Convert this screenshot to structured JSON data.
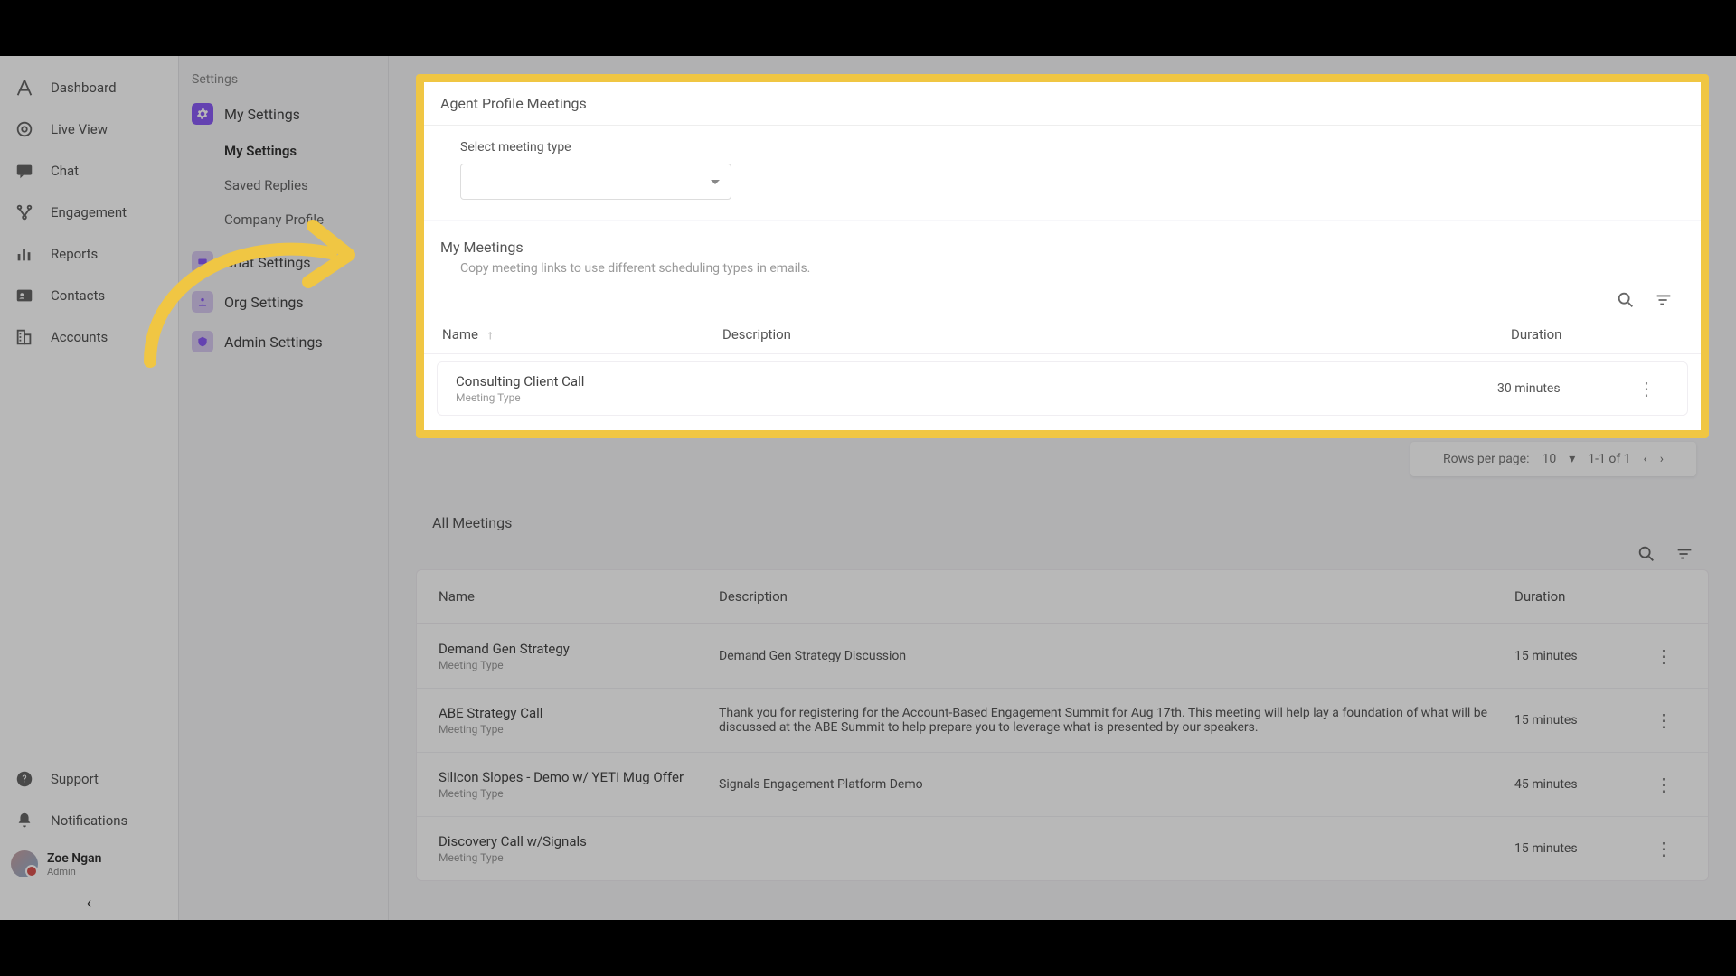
{
  "nav": {
    "items": [
      {
        "label": "Dashboard"
      },
      {
        "label": "Live View"
      },
      {
        "label": "Chat"
      },
      {
        "label": "Engagement"
      },
      {
        "label": "Reports"
      },
      {
        "label": "Contacts"
      },
      {
        "label": "Accounts"
      }
    ],
    "support": "Support",
    "notifications": "Notifications",
    "user": {
      "name": "Zoe Ngan",
      "role": "Admin"
    }
  },
  "settings": {
    "title": "Settings",
    "groups": {
      "my": {
        "label": "My Settings"
      },
      "chat": {
        "label": "Chat Settings"
      },
      "org": {
        "label": "Org Settings"
      },
      "admin": {
        "label": "Admin Settings"
      }
    },
    "my_items": [
      {
        "label": "My Settings",
        "active": true
      },
      {
        "label": "Saved Replies"
      },
      {
        "label": "Company Profile"
      }
    ]
  },
  "profile_card": {
    "title": "Agent Profile Meetings",
    "select_label": "Select meeting type"
  },
  "my_meetings": {
    "title": "My Meetings",
    "subtitle": "Copy meeting links to use different scheduling types in emails.",
    "cols": {
      "name": "Name",
      "desc": "Description",
      "dur": "Duration"
    },
    "rows": [
      {
        "name": "Consulting Client Call",
        "type": "Meeting Type",
        "desc": "",
        "dur": "30 minutes"
      }
    ],
    "pager": {
      "label": "Rows per page:",
      "size": "10",
      "range": "1-1 of 1"
    }
  },
  "all_meetings": {
    "title": "All Meetings",
    "cols": {
      "name": "Name",
      "desc": "Description",
      "dur": "Duration"
    },
    "rows": [
      {
        "name": "Demand Gen Strategy",
        "type": "Meeting Type",
        "desc": "Demand Gen Strategy Discussion",
        "dur": "15 minutes"
      },
      {
        "name": "ABE Strategy Call",
        "type": "Meeting Type",
        "desc": "Thank you for registering for the Account-Based Engagement Summit for Aug 17th. This meeting will help lay a foundation of what will be discussed at the ABE Summit to help prepare you to leverage what is presented by our speakers.",
        "dur": "15 minutes"
      },
      {
        "name": "Silicon Slopes - Demo w/ YETI Mug Offer",
        "type": "Meeting Type",
        "desc": "Signals Engagement Platform Demo",
        "dur": "45 minutes"
      },
      {
        "name": "Discovery Call w/Signals",
        "type": "Meeting Type",
        "desc": "",
        "dur": "15 minutes"
      }
    ]
  }
}
